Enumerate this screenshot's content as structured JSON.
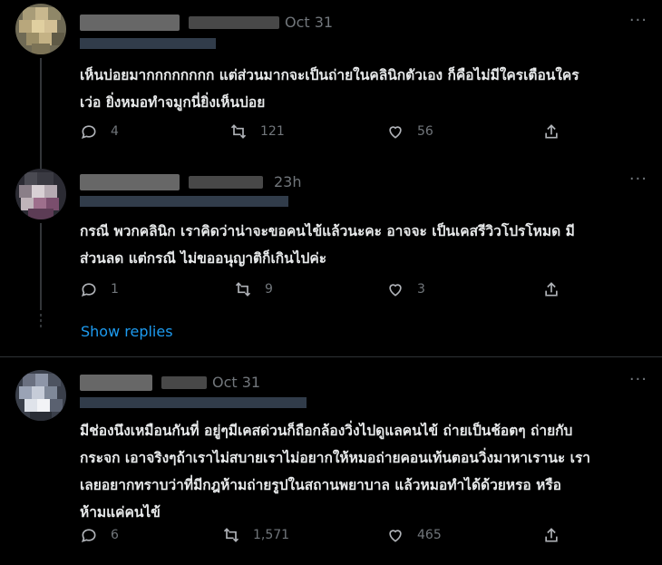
{
  "tweets": [
    {
      "date": "Oct 31",
      "text_line1": "เห็นบ่อยมากกกกกกกก แต่ส่วนมากจะเป็นถ่ายในคลินิกตัวเอง ก็คือไม่มีใครเตือนใคร",
      "text_line2": "เว่อ ยิ่งหมอทำจมูกนี่ยิ่งเห็นบ่อย",
      "replies": "4",
      "retweets": "121",
      "likes": "56"
    },
    {
      "date": "23h",
      "text_line1": "กรณี พวกคลินิก เราคิดว่าน่าจะขอคนไข้แล้วนะคะ  อาจจะ เป็นเคสรีวิวโปรโหมด มี",
      "text_line2": "ส่วนลด แต่กรณี ไม่ขออนุญาติก็เกินไปค่ะ",
      "replies": "1",
      "retweets": "9",
      "likes": "3"
    },
    {
      "date": "Oct 31",
      "text_line1": "มีช่องนึงเหมือนกันที่ อยู่ๆมีเคสด่วนก็ถือกล้องวิ่งไปดูแลคนไข้ ถ่ายเป็นช้อตๆ ถ่ายกับ",
      "text_line2": "กระจก เอาจริงๆถ้าเราไม่สบายเราไม่อยากให้หมอถ่ายคอนเท้นตอนวิ่งมาหาเรานะ เรา",
      "text_line3": "เลยอยากทราบว่าที่มีกฎห้ามถ่ายรูปในสถานพยาบาล แล้วหมอทำได้ด้วยหรอ หรือ",
      "text_line4": "ห้ามแค่คนไข้",
      "replies": "6",
      "retweets": "1,571",
      "likes": "465"
    }
  ],
  "show_replies_label": "Show replies",
  "more_label": "···",
  "colors": {
    "background": "#000000",
    "text": "#e7e9ea",
    "muted": "#71767b",
    "link": "#1d9bf0",
    "divider": "#2f3336"
  },
  "icons": [
    "reply-icon",
    "retweet-icon",
    "like-icon",
    "share-icon",
    "more-icon"
  ]
}
